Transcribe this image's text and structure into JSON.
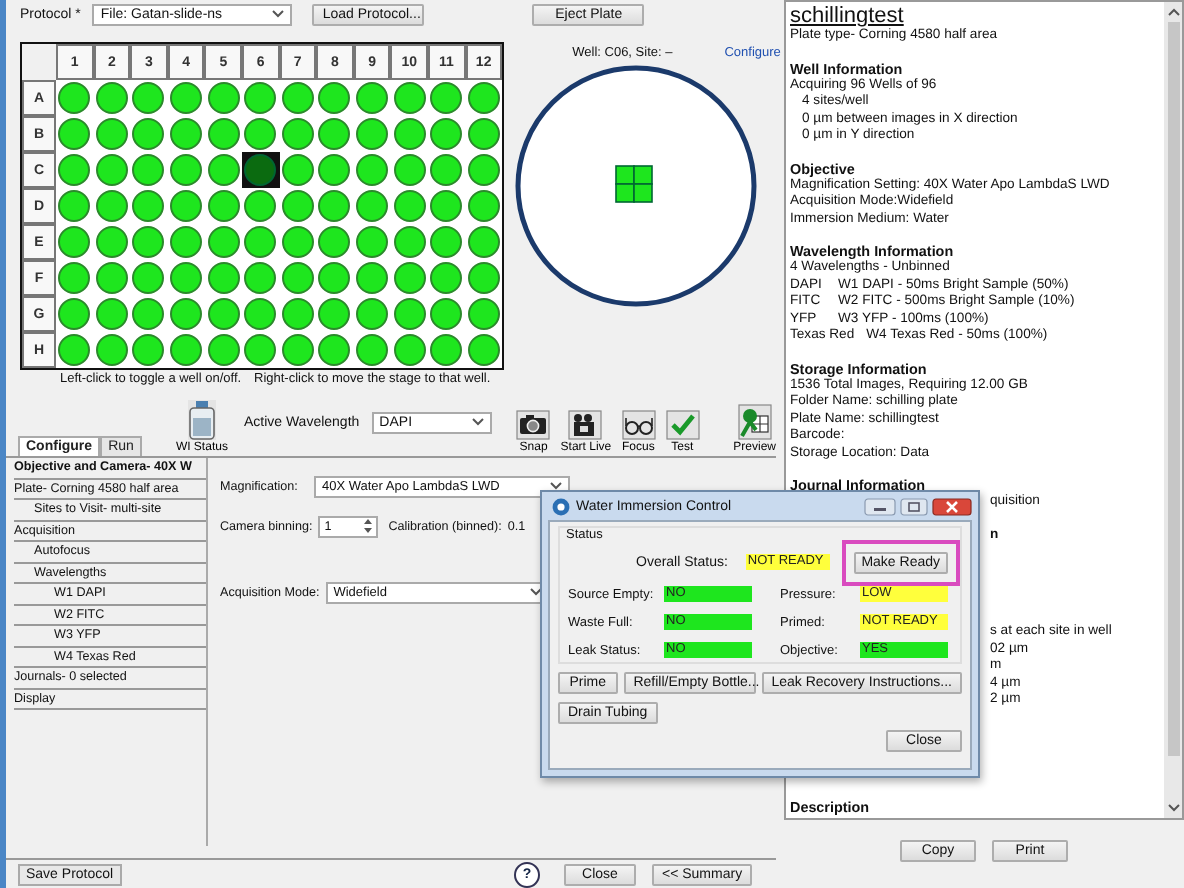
{
  "top_bar": {
    "protocol_label": "Protocol *",
    "protocol_file": "File: Gatan-slide-ns",
    "buttons": [
      "Load Protocol...",
      "Eject Plate"
    ]
  },
  "plate": {
    "columns": [
      "1",
      "2",
      "3",
      "4",
      "5",
      "6",
      "7",
      "8",
      "9",
      "10",
      "11",
      "12"
    ],
    "rows": [
      {
        "label": "A",
        "wells": [
          {
            "selected": false
          },
          {
            "selected": false
          },
          {
            "selected": false
          },
          {
            "selected": false
          },
          {
            "selected": false
          },
          {
            "selected": false
          },
          {
            "selected": false
          },
          {
            "selected": false
          },
          {
            "selected": false
          },
          {
            "selected": false
          },
          {
            "selected": false
          },
          {
            "selected": false
          }
        ]
      },
      {
        "label": "B",
        "wells": [
          {
            "selected": false
          },
          {
            "selected": false
          },
          {
            "selected": false
          },
          {
            "selected": false
          },
          {
            "selected": false
          },
          {
            "selected": false
          },
          {
            "selected": false
          },
          {
            "selected": false
          },
          {
            "selected": false
          },
          {
            "selected": false
          },
          {
            "selected": false
          },
          {
            "selected": false
          }
        ]
      },
      {
        "label": "C",
        "wells": [
          {
            "selected": false
          },
          {
            "selected": false
          },
          {
            "selected": false
          },
          {
            "selected": false
          },
          {
            "selected": false
          },
          {
            "selected": true
          },
          {
            "selected": false
          },
          {
            "selected": false
          },
          {
            "selected": false
          },
          {
            "selected": false
          },
          {
            "selected": false
          },
          {
            "selected": false
          }
        ]
      },
      {
        "label": "D",
        "wells": [
          {
            "selected": false
          },
          {
            "selected": false
          },
          {
            "selected": false
          },
          {
            "selected": false
          },
          {
            "selected": false
          },
          {
            "selected": false
          },
          {
            "selected": false
          },
          {
            "selected": false
          },
          {
            "selected": false
          },
          {
            "selected": false
          },
          {
            "selected": false
          },
          {
            "selected": false
          }
        ]
      },
      {
        "label": "E",
        "wells": [
          {
            "selected": false
          },
          {
            "selected": false
          },
          {
            "selected": false
          },
          {
            "selected": false
          },
          {
            "selected": false
          },
          {
            "selected": false
          },
          {
            "selected": false
          },
          {
            "selected": false
          },
          {
            "selected": false
          },
          {
            "selected": false
          },
          {
            "selected": false
          },
          {
            "selected": false
          }
        ]
      },
      {
        "label": "F",
        "wells": [
          {
            "selected": false
          },
          {
            "selected": false
          },
          {
            "selected": false
          },
          {
            "selected": false
          },
          {
            "selected": false
          },
          {
            "selected": false
          },
          {
            "selected": false
          },
          {
            "selected": false
          },
          {
            "selected": false
          },
          {
            "selected": false
          },
          {
            "selected": false
          },
          {
            "selected": false
          }
        ]
      },
      {
        "label": "G",
        "wells": [
          {
            "selected": false
          },
          {
            "selected": false
          },
          {
            "selected": false
          },
          {
            "selected": false
          },
          {
            "selected": false
          },
          {
            "selected": false
          },
          {
            "selected": false
          },
          {
            "selected": false
          },
          {
            "selected": false
          },
          {
            "selected": false
          },
          {
            "selected": false
          },
          {
            "selected": false
          }
        ]
      },
      {
        "label": "H",
        "wells": [
          {
            "selected": false
          },
          {
            "selected": false
          },
          {
            "selected": false
          },
          {
            "selected": false
          },
          {
            "selected": false
          },
          {
            "selected": false
          },
          {
            "selected": false
          },
          {
            "selected": false
          },
          {
            "selected": false
          },
          {
            "selected": false
          },
          {
            "selected": false
          },
          {
            "selected": false
          }
        ]
      }
    ]
  },
  "hints": [
    "Left-click to toggle a well on/off.",
    "Right-click to move the stage to that well."
  ],
  "stage": {
    "well_info": "Well: C06,  Site: –",
    "configure_link": "Configure"
  },
  "toolbar": {
    "wi_status": "WI Status",
    "wavelength_label": "Active Wavelength",
    "wavelength": "DAPI",
    "tools": [
      {
        "kind": "snap",
        "label": "Snap"
      },
      {
        "kind": "live",
        "label": "Start Live"
      },
      {
        "kind": "focus",
        "label": "Focus"
      },
      {
        "kind": "test",
        "label": "Test"
      },
      {
        "kind": "preview",
        "label": "Preview"
      }
    ]
  },
  "tabs": [
    {
      "label": "Configure",
      "selected": true
    },
    {
      "label": "Run",
      "selected": false
    }
  ],
  "tree": [
    {
      "label": "Objective and Camera- 40X W",
      "selected": true
    },
    {
      "label": "Plate- Corning 4580 half area",
      "selected": false,
      "children": [
        {
          "label": "Sites to Visit- multi-site",
          "selected": false
        }
      ]
    },
    {
      "label": "Acquisition",
      "selected": false,
      "children": [
        {
          "label": "Autofocus",
          "selected": false
        },
        {
          "label": "Wavelengths",
          "selected": false,
          "children": [
            {
              "label": "W1 DAPI",
              "selected": false
            },
            {
              "label": "W2 FITC",
              "selected": false
            },
            {
              "label": "W3 YFP",
              "selected": false
            },
            {
              "label": "W4 Texas Red",
              "selected": false
            }
          ]
        }
      ]
    },
    {
      "label": "Journals- 0 selected",
      "selected": false
    },
    {
      "label": "Display",
      "selected": false
    }
  ],
  "form": {
    "magnification_label": "Magnification:",
    "magnification": "40X Water Apo LambdaS LWD",
    "binning_label": "Camera binning:",
    "binning": "1",
    "calibration_label": "Calibration (binned):",
    "calibration": "0.1",
    "mode_label": "Acquisition Mode:",
    "mode": "Widefield"
  },
  "bottom_bar": {
    "save": "Save Protocol",
    "help": "?",
    "buttons": [
      "Close",
      "<< Summary"
    ]
  },
  "summary": {
    "title": "schillingtest",
    "subtitle": "Plate type- Corning 4580 half area",
    "sections": [
      {
        "heading": "Well Information",
        "lines": [
          {
            "kind": "text",
            "text": "Acquiring 96 Wells of 96",
            "children": [
              {
                "kind": "text",
                "text": "4 sites/well"
              },
              {
                "kind": "text",
                "text": "0 µm between images in X direction"
              },
              {
                "kind": "text",
                "text": "0 µm in Y direction"
              }
            ]
          }
        ]
      },
      {
        "heading": "Objective",
        "lines": [
          {
            "kind": "text",
            "text": "Magnification Setting: 40X Water Apo LambdaS LWD"
          },
          {
            "kind": "text",
            "text": "Acquisition Mode:Widefield"
          },
          {
            "kind": "text",
            "text": "Immersion Medium: Water"
          }
        ]
      },
      {
        "heading": "Wavelength Information",
        "lines": [
          {
            "kind": "text",
            "text": "4 Wavelengths - Unbinned"
          },
          {
            "kind": "wavelength",
            "name": "DAPI",
            "text": "W1 DAPI - 50ms Bright Sample (50%)"
          },
          {
            "kind": "wavelength",
            "name": "FITC",
            "text": "W2 FITC - 500ms Bright Sample (10%)"
          },
          {
            "kind": "wavelength",
            "name": "YFP",
            "text": "W3 YFP - 100ms (100%)"
          },
          {
            "kind": "wavelength",
            "name": "Texas Red",
            "text": "W4 Texas Red - 50ms (100%)"
          }
        ]
      },
      {
        "heading": "Storage Information",
        "lines": [
          {
            "kind": "text",
            "text": "1536 Total Images,  Requiring 12.00 GB"
          },
          {
            "kind": "text",
            "text": "Folder Name: schilling plate"
          },
          {
            "kind": "text",
            "text": "Plate Name: schillingtest"
          },
          {
            "kind": "text",
            "text": "Barcode:"
          },
          {
            "kind": "text",
            "text": "Storage Location: Data"
          }
        ]
      },
      {
        "heading": "Journal Information",
        "lines": [
          {
            "kind": "covered",
            "text": "quisition"
          },
          {
            "kind": "covered-heading",
            "text": "n"
          },
          {
            "kind": "covered-gap",
            "text": "s at each site in well"
          },
          {
            "kind": "covered",
            "text": "02 µm"
          },
          {
            "kind": "covered",
            "text": "m"
          },
          {
            "kind": "covered",
            "text": "4 µm"
          },
          {
            "kind": "covered",
            "text": "2 µm"
          }
        ]
      },
      {
        "heading": "Description"
      }
    ]
  },
  "summary_buttons": [
    "Copy",
    "Print"
  ],
  "dialog": {
    "title": "Water Immersion Control",
    "group_label": "Status",
    "overall": {
      "label": "Overall Status:",
      "value": "NOT READY",
      "color": "#ffff3c"
    },
    "make_ready": {
      "label": "Make Ready",
      "highlighted": true
    },
    "indicators": [
      {
        "label": "Source Empty:",
        "value": "NO",
        "color": "#1ee61e"
      },
      {
        "label": "Pressure:",
        "value": "LOW",
        "color": "#ffff3c"
      },
      {
        "label": "Waste Full:",
        "value": "NO",
        "color": "#1ee61e"
      },
      {
        "label": "Primed:",
        "value": "NOT READY",
        "color": "#ffff3c"
      },
      {
        "label": "Leak Status:",
        "value": "NO",
        "color": "#1ee61e"
      },
      {
        "label": "Objective:",
        "value": "YES",
        "color": "#1ee61e"
      }
    ],
    "buttons": [
      "Prime",
      "Refill/Empty Bottle...",
      "Leak Recovery Instructions..."
    ],
    "drain": "Drain Tubing",
    "close": "Close"
  }
}
